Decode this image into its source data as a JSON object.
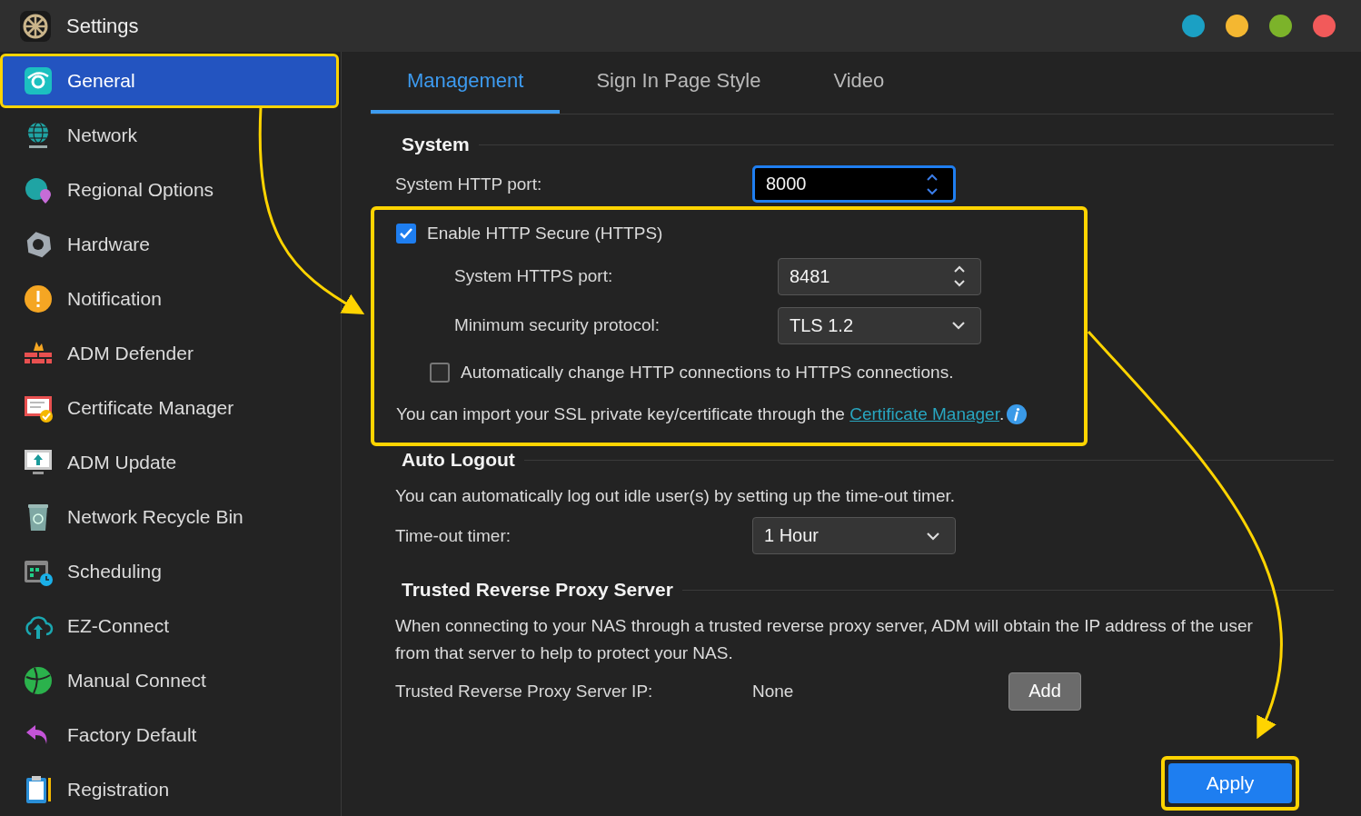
{
  "window": {
    "title": "Settings"
  },
  "window_controls": [
    {
      "color": "#1ba0c4"
    },
    {
      "color": "#f4b731"
    },
    {
      "color": "#7cb32a"
    },
    {
      "color": "#f25a5a"
    }
  ],
  "sidebar": {
    "items": [
      {
        "label": "General",
        "selected": true
      },
      {
        "label": "Network",
        "selected": false
      },
      {
        "label": "Regional Options",
        "selected": false
      },
      {
        "label": "Hardware",
        "selected": false
      },
      {
        "label": "Notification",
        "selected": false
      },
      {
        "label": "ADM Defender",
        "selected": false
      },
      {
        "label": "Certificate Manager",
        "selected": false
      },
      {
        "label": "ADM Update",
        "selected": false
      },
      {
        "label": "Network Recycle Bin",
        "selected": false
      },
      {
        "label": "Scheduling",
        "selected": false
      },
      {
        "label": "EZ-Connect",
        "selected": false
      },
      {
        "label": "Manual Connect",
        "selected": false
      },
      {
        "label": "Factory Default",
        "selected": false
      },
      {
        "label": "Registration",
        "selected": false
      }
    ]
  },
  "tabs": [
    {
      "label": "Management",
      "selected": true
    },
    {
      "label": "Sign In Page Style",
      "selected": false
    },
    {
      "label": "Video",
      "selected": false
    }
  ],
  "system": {
    "heading": "System",
    "http_port": {
      "label": "System HTTP port:",
      "value": "8000"
    }
  },
  "https": {
    "enable": {
      "label": "Enable HTTP Secure (HTTPS)",
      "checked": true
    },
    "port": {
      "label": "System HTTPS port:",
      "value": "8481"
    },
    "protocol": {
      "label": "Minimum security protocol:",
      "value": "TLS 1.2"
    },
    "redirect": {
      "label": "Automatically change HTTP connections to HTTPS connections.",
      "checked": false
    },
    "note": {
      "text": "You can import your SSL private key/certificate through the ",
      "link": "Certificate Manager",
      "after": "."
    }
  },
  "auto_logout": {
    "heading": "Auto Logout",
    "description": "You can automatically log out idle user(s) by setting up the time-out timer.",
    "timer": {
      "label": "Time-out timer:",
      "value": "1 Hour"
    }
  },
  "proxy": {
    "heading": "Trusted Reverse Proxy Server",
    "description": "When connecting to your NAS through a trusted reverse proxy server, ADM will obtain the IP address of the user from that server to help to protect your NAS.",
    "ip": {
      "label": "Trusted Reverse Proxy Server IP:",
      "value": "None"
    },
    "add_button": "Add"
  },
  "apply_button": "Apply"
}
